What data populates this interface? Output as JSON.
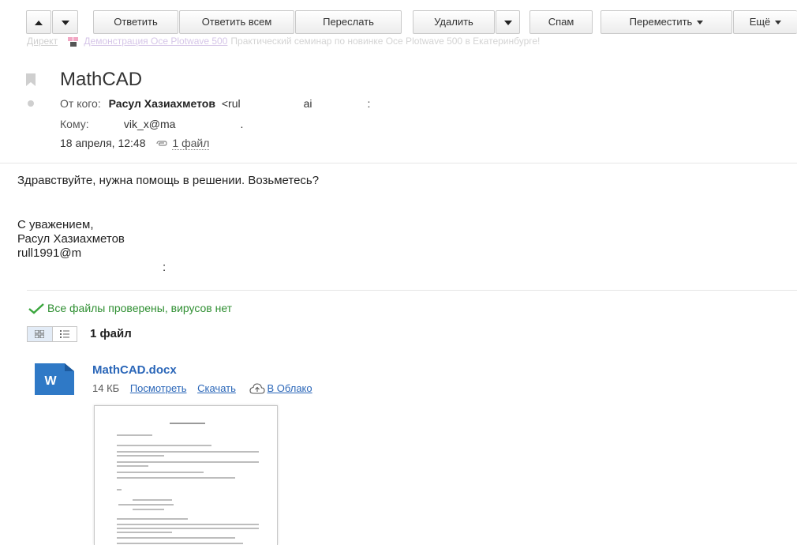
{
  "toolbar": {
    "reply": "Ответить",
    "reply_all": "Ответить всем",
    "forward": "Переслать",
    "delete": "Удалить",
    "spam": "Спам",
    "move": "Переместить",
    "more": "Ещё"
  },
  "ad": {
    "direct_label": "Директ",
    "link_text": "Демонстрация Oce Plotwave 500",
    "text": "Практический семинар по новинке Oce Plotwave 500 в Екатеринбурге!"
  },
  "message": {
    "subject": "MathCAD",
    "from_label": "От кого:",
    "from_name": "Расул Хазиахметов",
    "from_addr_partial_1": "<rul",
    "from_addr_partial_2": "ai",
    "from_addr_end": ":",
    "to_label": "Кому:",
    "to_addr": "vik_x@ma",
    "to_end": ".",
    "date": "18 апреля, 12:48",
    "attach_label": "1 файл"
  },
  "body": {
    "greeting": "Здравствуйте, нужна помощь в решении. Возьметесь?",
    "sign_1": "С уважением,",
    "sign_2": "Расул Хазиахметов",
    "sign_3": "rull1991@m",
    "sign_3_end": ":"
  },
  "attachments": {
    "virus_status": "Все файлы проверены, вирусов нет",
    "count_label": "1 файл",
    "file": {
      "name": "MathCAD.docx",
      "size": "14 КБ",
      "view": "Посмотреть",
      "download": "Скачать",
      "cloud": "В Облако",
      "icon_letter": "W"
    }
  },
  "colors": {
    "link": "#2a66b8",
    "virus_ok": "#2f8f32",
    "word_icon": "#2f79c6"
  }
}
